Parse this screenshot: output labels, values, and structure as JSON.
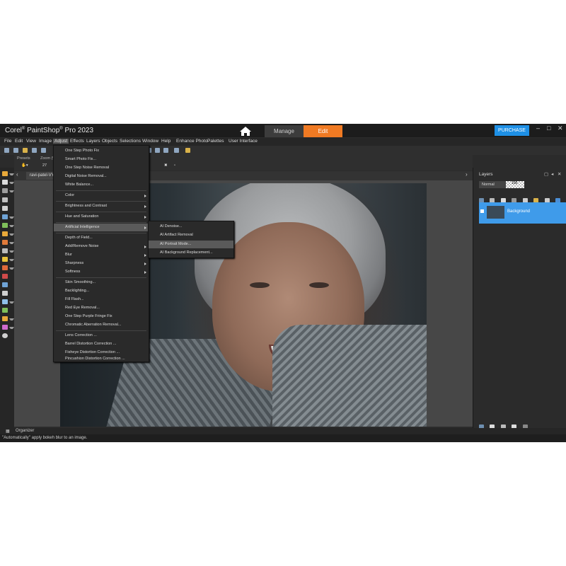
{
  "app": {
    "title_brand": "Corel",
    "title_product": "PaintShop",
    "title_suffix": "Pro 2023",
    "sup": "®"
  },
  "modes": {
    "manage": "Manage",
    "edit": "Edit"
  },
  "purchase": "PURCHASE",
  "window_controls": [
    "–",
    "□",
    "✕"
  ],
  "menubar": [
    "File",
    "Edit",
    "View",
    "Image",
    "Adjust",
    "Effects",
    "Layers",
    "Objects",
    "Selections",
    "Window",
    "Help",
    "Enhance Photo",
    "Palettes",
    "User Interface"
  ],
  "options": {
    "presets_label": "Presets",
    "zoom_label": "Zoom (%)",
    "zoom_value": "27"
  },
  "doc_tab": "ravi-patel-VY",
  "adjust_menu": [
    "One Step Photo Fix",
    "Smart Photo Fix...",
    "One Step Noise Removal",
    "Digital Noise Removal...",
    "White Balance...",
    "Color",
    "Brightness and Contrast",
    "Hue and Saturation",
    "Artificial Intelligence",
    "Depth of Field...",
    "Add/Remove Noise",
    "Blur",
    "Sharpness",
    "Softness",
    "Skin Smoothing...",
    "Backlighting...",
    "Fill Flash...",
    "Red Eye Removal...",
    "One Step Purple Fringe Fix",
    "Chromatic Aberration Removal...",
    "Lens Correction ...",
    "Barrel Distortion Correction ...",
    "Fisheye Distortion Correction ...",
    "Pincushion Distortion Correction ..."
  ],
  "ai_submenu": [
    "AI Denoise...",
    "AI Artifact Removal",
    "AI Portrait Mode...",
    "AI Background Replacement..."
  ],
  "layers": {
    "title": "Layers",
    "blend_mode": "Normal",
    "opacity": "100",
    "layer_name": "Background"
  },
  "organizer": "Organizer",
  "status": "\"Automatically\" apply bokeh blur to an image.",
  "colors": {
    "accent_orange": "#f07a23",
    "purchase_blue": "#1e90e6",
    "layer_selected": "#3f9bea"
  }
}
